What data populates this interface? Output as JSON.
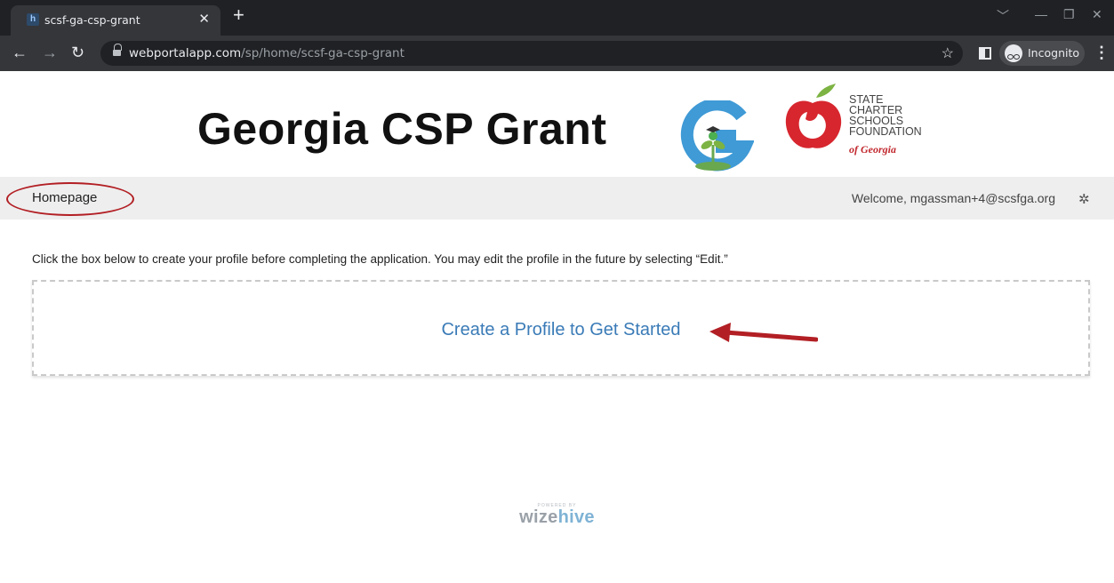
{
  "browser": {
    "tab_title": "scsf-ga-csp-grant",
    "tab_favicon_letter": "h",
    "new_tab_symbol": "+",
    "url_host": "webportalapp.com",
    "url_path": "/sp/home/scsf-ga-csp-grant",
    "profile_label": "Incognito"
  },
  "header": {
    "site_title": "Georgia CSP Grant",
    "foundation_lines": [
      "STATE",
      "CHARTER",
      "SCHOOLS",
      "FOUNDATION"
    ],
    "foundation_of": "of Georgia"
  },
  "navbar": {
    "home_label": "Homepage",
    "welcome_text": "Welcome, mgassman+4@scsfga.org"
  },
  "main": {
    "instructions": "Click the box below to create your profile before completing the application. You may edit the profile in the future by selecting “Edit.”",
    "profile_link": "Create a Profile to Get Started"
  },
  "footer": {
    "powered_by": "POWERED BY",
    "brand_part1": "wize",
    "brand_part2": "hive"
  },
  "colors": {
    "annotation_red": "#b21f24",
    "link_blue": "#3a7bb7",
    "navbar_gray": "#eeeeee"
  }
}
